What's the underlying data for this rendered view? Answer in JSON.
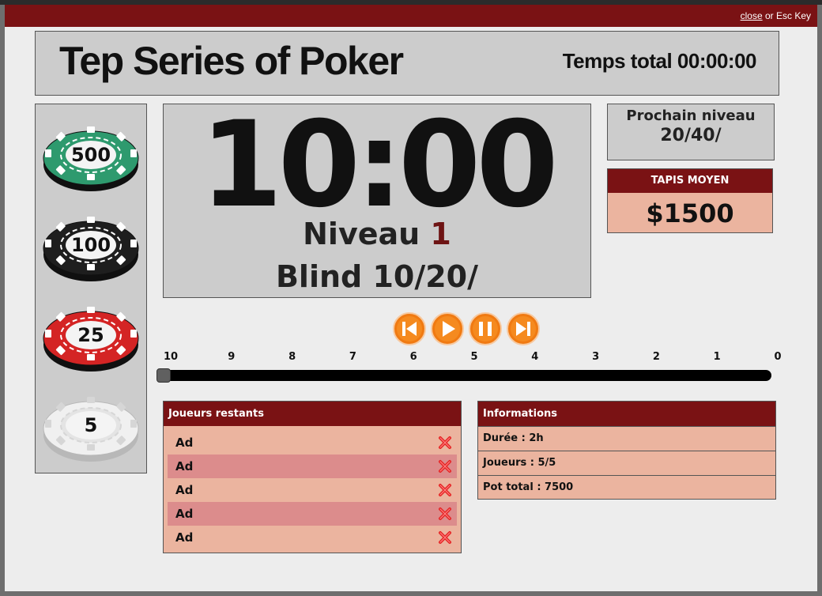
{
  "window": {
    "close_link": "close",
    "close_hint": " or Esc Key"
  },
  "header": {
    "title": "Tep Series of Poker",
    "total_time_label": "Temps total",
    "total_time_value": "00:00:00"
  },
  "chips": [
    {
      "value": "500",
      "color": "#2e9a6e",
      "icon": "poker-chip-green-icon"
    },
    {
      "value": "100",
      "color": "#1e1e1e",
      "icon": "poker-chip-black-icon"
    },
    {
      "value": "25",
      "color": "#d42424",
      "icon": "poker-chip-red-icon"
    },
    {
      "value": "5",
      "color": "#f0f0f0",
      "icon": "poker-chip-white-icon"
    }
  ],
  "timer": {
    "clock": "10:00",
    "level_label": "Niveau",
    "level_number": "1",
    "blind_label": "Blind",
    "blind_value": "10/20/"
  },
  "next_level": {
    "label": "Prochain niveau",
    "value": "20/40/"
  },
  "average_stack": {
    "label": "TAPIS MOYEN",
    "value": "$1500"
  },
  "controls": [
    {
      "name": "previous-level-button",
      "icon": "skip-back-icon"
    },
    {
      "name": "play-button",
      "icon": "play-icon"
    },
    {
      "name": "pause-button",
      "icon": "pause-icon"
    },
    {
      "name": "next-level-button",
      "icon": "skip-forward-icon"
    }
  ],
  "progress": {
    "ticks": [
      "10",
      "9",
      "8",
      "7",
      "6",
      "5",
      "4",
      "3",
      "2",
      "1",
      "0"
    ],
    "value_fraction": 0
  },
  "players": {
    "title": "Joueurs restants",
    "rows": [
      "Ad",
      "Ad",
      "Ad",
      "Ad",
      "Ad"
    ]
  },
  "info": {
    "title": "Informations",
    "duration": "Durée : 2h",
    "players": "Joueurs : 5/5",
    "pot": "Pot total : 7500"
  },
  "colors": {
    "accent": "#7a1214",
    "panel": "#cccccc",
    "salmon": "#ebb49f",
    "row_alt": "#dc8c8c",
    "control_orange": "#f07a12"
  }
}
